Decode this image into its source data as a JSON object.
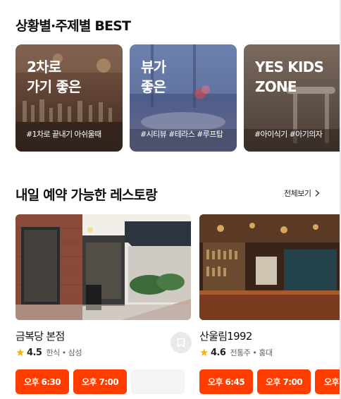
{
  "sections": {
    "best_title": "상황별·주제별 BEST",
    "tomorrow_title": "내일 예약 가능한 레스토랑",
    "see_all": "전체보기"
  },
  "theme_cards": [
    {
      "title": "2차로\n가기 좋은",
      "tags": "#1차로 끝내기 아쉬울때"
    },
    {
      "title": "뷰가\n좋은",
      "tags": "#시티뷰 #테라스 #루프탑"
    },
    {
      "title": "YES KIDS\nZONE",
      "tags": "#아이식기 #아기의자"
    }
  ],
  "restaurants": [
    {
      "name": "금복당 본점",
      "rating": "4.5",
      "category": "한식 • 삼성",
      "times": [
        "오후 6:30",
        "오후 7:00",
        ""
      ]
    },
    {
      "name": "산울림1992",
      "rating": "4.6",
      "category": "전통주 • 홍대",
      "times": [
        "오후 6:45",
        "오후 7:00",
        "오후"
      ]
    }
  ],
  "icons": {
    "star": "star-icon",
    "bookmark": "bookmark-icon",
    "chevron": "chevron-right-icon"
  },
  "colors": {
    "accent": "#ff3d00",
    "star": "#f5b301"
  }
}
